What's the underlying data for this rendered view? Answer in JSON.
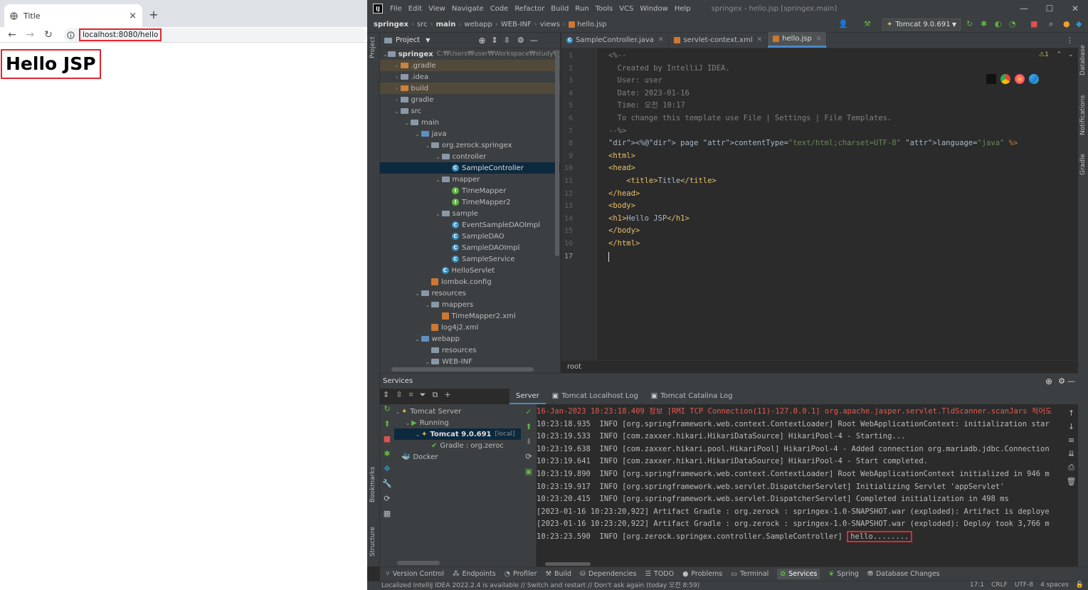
{
  "browser": {
    "tab_title": "Title",
    "url": "localhost:8080/hello",
    "page_heading": "Hello JSP"
  },
  "ide": {
    "menu": [
      "File",
      "Edit",
      "View",
      "Navigate",
      "Code",
      "Refactor",
      "Build",
      "Run",
      "Tools",
      "VCS",
      "Window",
      "Help"
    ],
    "window_title": "springex - hello.jsp [springex.main]",
    "breadcrumbs": [
      "springex",
      "src",
      "main",
      "webapp",
      "WEB-INF",
      "views",
      "hello.jsp"
    ],
    "run_config": "Tomcat 9.0.691",
    "project_label": "Project",
    "project_tree": [
      {
        "label": "springex",
        "sub": "C:₩Users₩user₩Workspace₩study₩Java",
        "indent": 0,
        "icon": "module",
        "arrow": "v"
      },
      {
        "label": ".gradle",
        "indent": 1,
        "icon": "folder-orange",
        "arrow": ">",
        "hl": true
      },
      {
        "label": ".idea",
        "indent": 1,
        "icon": "folder",
        "arrow": ">"
      },
      {
        "label": "build",
        "indent": 1,
        "icon": "folder-orange",
        "arrow": ">",
        "hl": true
      },
      {
        "label": "gradle",
        "indent": 1,
        "icon": "folder",
        "arrow": ">"
      },
      {
        "label": "src",
        "indent": 1,
        "icon": "folder",
        "arrow": "v"
      },
      {
        "label": "main",
        "indent": 2,
        "icon": "folder",
        "arrow": "v"
      },
      {
        "label": "java",
        "indent": 3,
        "icon": "folder-blue",
        "arrow": "v"
      },
      {
        "label": "org.zerock.springex",
        "indent": 4,
        "icon": "folder",
        "arrow": "v"
      },
      {
        "label": "controller",
        "indent": 5,
        "icon": "folder",
        "arrow": "v"
      },
      {
        "label": "SampleController",
        "indent": 6,
        "icon": "class",
        "arrow": "",
        "sel": true
      },
      {
        "label": "mapper",
        "indent": 5,
        "icon": "folder",
        "arrow": "v"
      },
      {
        "label": "TimeMapper",
        "indent": 6,
        "icon": "interface",
        "arrow": ""
      },
      {
        "label": "TimeMapper2",
        "indent": 6,
        "icon": "interface",
        "arrow": ""
      },
      {
        "label": "sample",
        "indent": 5,
        "icon": "folder",
        "arrow": "v"
      },
      {
        "label": "EventSampleDAOImpl",
        "indent": 6,
        "icon": "class",
        "arrow": ""
      },
      {
        "label": "SampleDAO",
        "indent": 6,
        "icon": "class",
        "arrow": ""
      },
      {
        "label": "SampleDAOImpl",
        "indent": 6,
        "icon": "class",
        "arrow": ""
      },
      {
        "label": "SampleService",
        "indent": 6,
        "icon": "class",
        "arrow": ""
      },
      {
        "label": "HelloServlet",
        "indent": 5,
        "icon": "class",
        "arrow": ""
      },
      {
        "label": "lombok.config",
        "indent": 4,
        "icon": "config",
        "arrow": ""
      },
      {
        "label": "resources",
        "indent": 3,
        "icon": "folder",
        "arrow": "v"
      },
      {
        "label": "mappers",
        "indent": 4,
        "icon": "folder",
        "arrow": "v"
      },
      {
        "label": "TimeMapper2.xml",
        "indent": 5,
        "icon": "xml",
        "arrow": ""
      },
      {
        "label": "log4j2.xml",
        "indent": 4,
        "icon": "xml",
        "arrow": ""
      },
      {
        "label": "webapp",
        "indent": 3,
        "icon": "folder-blue",
        "arrow": "v"
      },
      {
        "label": "resources",
        "indent": 4,
        "icon": "folder",
        "arrow": ""
      },
      {
        "label": "WEB-INF",
        "indent": 4,
        "icon": "folder",
        "arrow": "v"
      }
    ],
    "editor_tabs": [
      {
        "label": "SampleController.java",
        "active": false
      },
      {
        "label": "servlet-context.xml",
        "active": false
      },
      {
        "label": "hello.jsp",
        "active": true
      }
    ],
    "warning_count": "1",
    "line_numbers": [
      "1",
      "2",
      "3",
      "4",
      "5",
      "6",
      "7",
      "8",
      "9",
      "10",
      "11",
      "12",
      "13",
      "14",
      "15",
      "16",
      "17"
    ],
    "code": [
      "<%--",
      "  Created by IntelliJ IDEA.",
      "  User: user",
      "  Date: 2023-01-16",
      "  Time: 오전 10:17",
      "  To change this template use File | Settings | File Templates.",
      "--%>",
      "<%@ page contentType=\"text/html;charset=UTF-8\" language=\"java\" %>",
      "<html>",
      "<head>",
      "    <title>Title</title>",
      "</head>",
      "<body>",
      "<h1>Hello JSP</h1>",
      "</body>",
      "</html>",
      ""
    ],
    "editor_breadcrumb": "root",
    "services_label": "Services",
    "services_tree": [
      {
        "label": "Tomcat Server",
        "indent": 0
      },
      {
        "label": "Running",
        "indent": 1
      },
      {
        "label": "Tomcat 9.0.691",
        "sub": "[local]",
        "indent": 2,
        "sel": true
      },
      {
        "label": "Gradle : org.zeroc",
        "indent": 3
      },
      {
        "label": "Docker",
        "indent": 0
      }
    ],
    "log_tabs": [
      "Server",
      "Tomcat Localhost Log",
      "Tomcat Catalina Log"
    ],
    "log_lines": [
      "16-Jan-2023 10:23:18.409 정보 [RMI TCP Connection(11)-127.0.0.1] org.apache.jasper.servlet.TldScanner.scanJars 적어도",
      "10:23:18.935  INFO [org.springframework.web.context.ContextLoader] Root WebApplicationContext: initialization star",
      "10:23:19.533  INFO [com.zaxxer.hikari.HikariDataSource] HikariPool-4 - Starting...",
      "10:23:19.638  INFO [com.zaxxer.hikari.pool.HikariPool] HikariPool-4 - Added connection org.mariadb.jdbc.Connection",
      "10:23:19.641  INFO [com.zaxxer.hikari.HikariDataSource] HikariPool-4 - Start completed.",
      "10:23:19.890  INFO [org.springframework.web.context.ContextLoader] Root WebApplicationContext initialized in 946 m",
      "10:23:19.917  INFO [org.springframework.web.servlet.DispatcherServlet] Initializing Servlet 'appServlet'",
      "10:23:20.415  INFO [org.springframework.web.servlet.DispatcherServlet] Completed initialization in 498 ms",
      "[2023-01-16 10:23:20,922] Artifact Gradle : org.zerock : springex-1.0-SNAPSHOT.war (exploded): Artifact is deploye",
      "[2023-01-16 10:23:20,922] Artifact Gradle : org.zerock : springex-1.0-SNAPSHOT.war (exploded): Deploy took 3,766 m"
    ],
    "last_log_prefix": "10:23:23.590  INFO [org.zerock.springex.controller.SampleController] ",
    "last_log_hello": "hello........",
    "bottom_tools": [
      "Version Control",
      "Endpoints",
      "Profiler",
      "Build",
      "Dependencies",
      "TODO",
      "Problems",
      "Terminal",
      "Services",
      "Spring",
      "Database Changes"
    ],
    "active_bottom_tool": "Services",
    "status_message": "Localized IntelliJ IDEA 2022.2.4 is available // Switch and restart // Don't ask again (today 오전 8:59)",
    "status_right": [
      "17:1",
      "CRLF",
      "UTF-8",
      "4 spaces"
    ],
    "side_labels": {
      "project": "Project",
      "bookmarks": "Bookmarks",
      "structure": "Structure",
      "database": "Database",
      "notifications": "Notifications",
      "gradle": "Gradle"
    }
  }
}
